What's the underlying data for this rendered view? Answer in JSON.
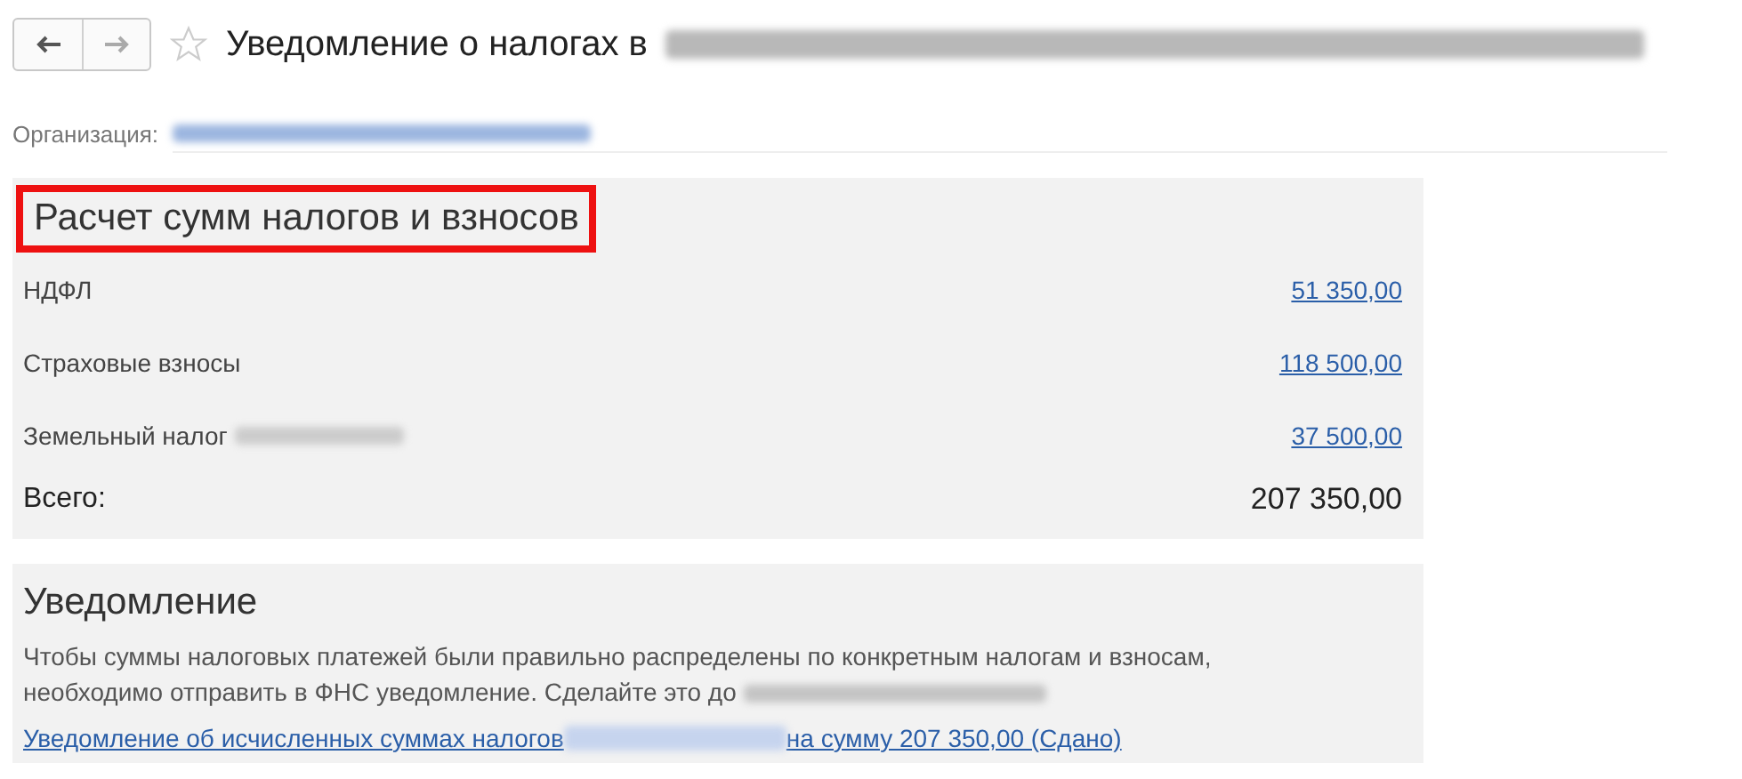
{
  "header": {
    "title": "Уведомление о налогах в",
    "favorite": false
  },
  "organization": {
    "label": "Организация:"
  },
  "calculation": {
    "title": "Расчет сумм налогов и взносов",
    "highlighted": true,
    "rows": [
      {
        "name": "НДФЛ",
        "amount": "51 350,00",
        "blurred_note": false
      },
      {
        "name": "Страховые взносы",
        "amount": "118 500,00",
        "blurred_note": false
      },
      {
        "name": "Земельный налог",
        "amount": "37 500,00",
        "blurred_note": true
      }
    ],
    "total": {
      "label": "Всего:",
      "amount": "207 350,00"
    }
  },
  "notice": {
    "title": "Уведомление",
    "text": "Чтобы суммы налоговых платежей были правильно распределены по конкретным налогам и взносам, необходимо отправить в ФНС уведомление. Сделайте это до",
    "link_start": "Уведомление об исчисленных суммах налогов",
    "link_end": "на сумму 207 350,00 (Сдано)"
  }
}
